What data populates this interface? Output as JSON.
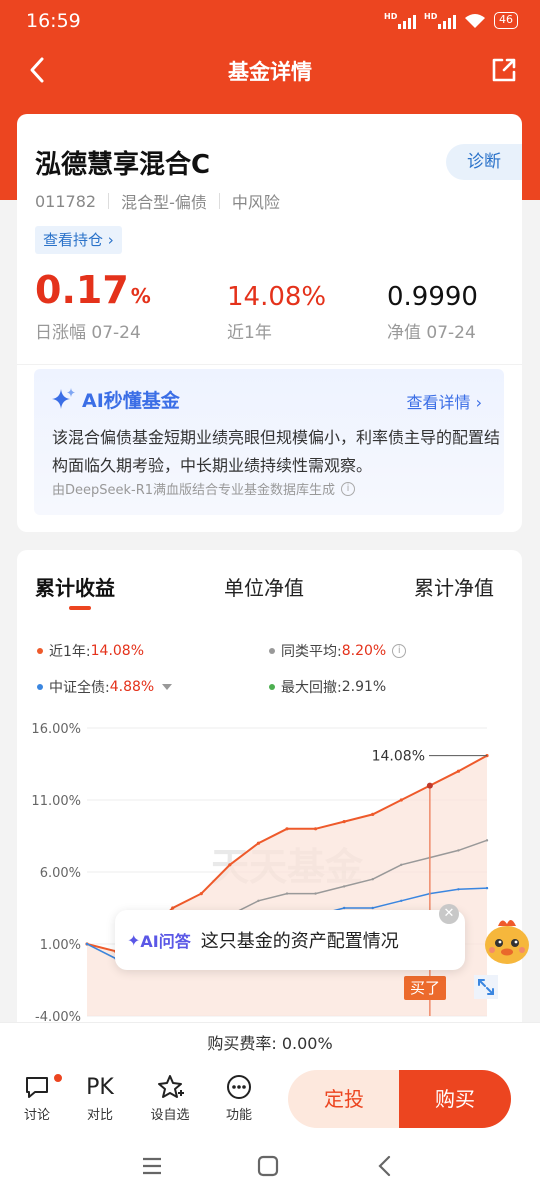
{
  "status": {
    "time": "16:59",
    "hd1": "HD",
    "hd2": "HD",
    "battery": "46"
  },
  "nav": {
    "title": "基金详情"
  },
  "fund": {
    "name": "泓德慧享混合C",
    "code": "011782",
    "type": "混合型-偏债",
    "risk": "中风险",
    "diagnose_label": "诊断",
    "holdings_label": "查看持仓",
    "daily_change": "0.17",
    "daily_change_unit": "%",
    "daily_label": "日涨幅 07-24",
    "year_return": "14.08%",
    "year_label": "近1年",
    "nav_value": "0.9990",
    "nav_label": "净值 07-24"
  },
  "ai_summary": {
    "title": "AI秒懂基金",
    "more": "查看详情",
    "text": "该混合偏债基金短期业绩亮眼但规模偏小，利率债主导的配置结构面临久期考验，中长期业绩持续性需观察。",
    "footer": "由DeepSeek-R1满血版结合专业基金数据库生成"
  },
  "tabs": [
    "累计收益",
    "单位净值",
    "累计净值"
  ],
  "legend": {
    "fund_label": "近1年:",
    "fund_value": "14.08%",
    "peer_label": "同类平均:",
    "peer_value": "8.20%",
    "index_label": "中证全债:",
    "index_value": "4.88%",
    "drawdown_label": "最大回撤:",
    "drawdown_value": "2.91%"
  },
  "colors": {
    "fund": "#ee5a2b",
    "peer": "#999999",
    "index": "#3a86e0",
    "drawdown": "#4caf50",
    "accent": "#ec4520"
  },
  "chart_data": {
    "type": "line",
    "y_ticks": [
      "16.00%",
      "11.00%",
      "6.00%",
      "1.00%",
      "-4.00%"
    ],
    "ylim": [
      -4,
      16
    ],
    "end_label": "14.08%",
    "watermark": "天天基金",
    "series": [
      {
        "name": "近1年",
        "values": [
          1.0,
          0.5,
          1.5,
          3.5,
          4.5,
          6.5,
          8.0,
          9.0,
          9.0,
          9.5,
          10.0,
          11.0,
          12.0,
          13.0,
          14.08
        ]
      },
      {
        "name": "同类平均",
        "values": [
          1.0,
          0.0,
          0.5,
          1.0,
          2.0,
          3.0,
          4.0,
          4.5,
          4.5,
          5.0,
          5.5,
          6.5,
          7.0,
          7.5,
          8.2
        ]
      },
      {
        "name": "中证全债",
        "values": [
          1.0,
          0.0,
          0.5,
          1.0,
          1.5,
          2.0,
          2.5,
          3.0,
          3.0,
          3.5,
          3.5,
          4.0,
          4.5,
          4.8,
          4.88
        ]
      }
    ]
  },
  "ai_ask": {
    "tag": "AI问答",
    "question": "这只基金的资产配置情况"
  },
  "buy_tag": "买了",
  "fee": "购买费率: 0.00%",
  "actions": [
    {
      "label": "讨论"
    },
    {
      "label": "对比",
      "glyph": "PK"
    },
    {
      "label": "设自选"
    },
    {
      "label": "功能"
    }
  ],
  "buttons": {
    "sip": "定投",
    "buy": "购买"
  }
}
